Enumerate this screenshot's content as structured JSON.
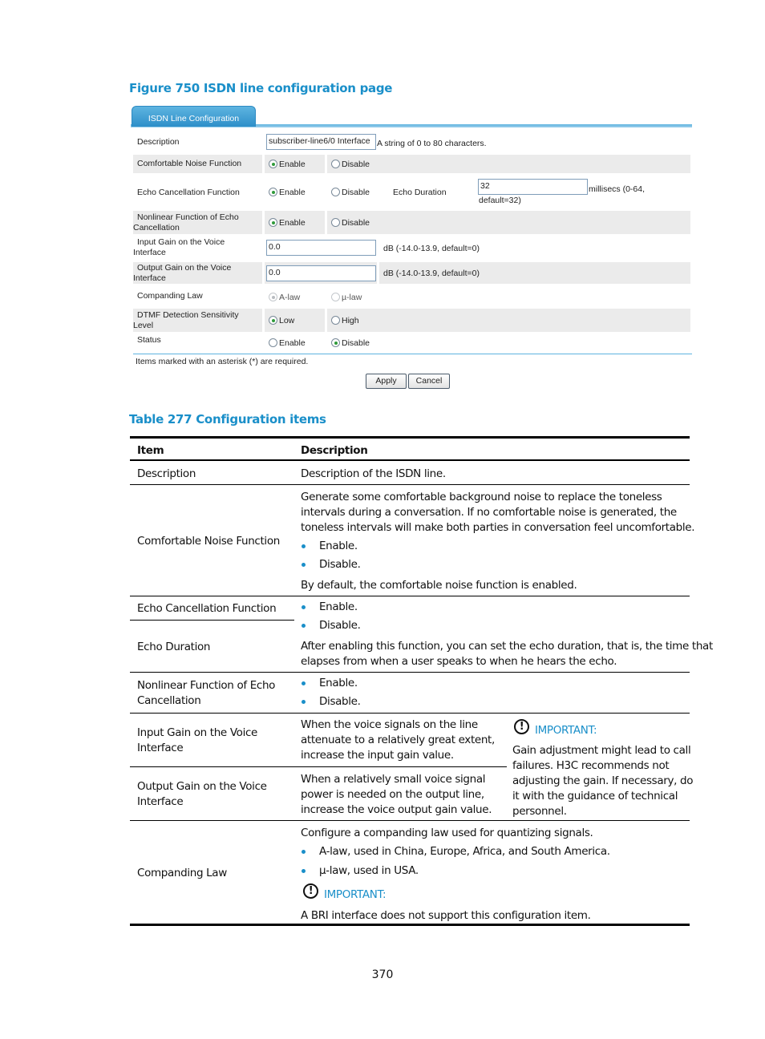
{
  "figure_caption": "Figure 750 ISDN line configuration page",
  "ui": {
    "tab_label": "ISDN Line Configuration",
    "rows": {
      "description": {
        "label": "Description",
        "value": "subscriber-line6/0 Interface",
        "hint": "A string of 0 to 80 characters."
      },
      "comfort_noise": {
        "label": "Comfortable Noise Function",
        "opt1": "Enable",
        "opt2": "Disable",
        "selected": "Enable"
      },
      "echo_cancel": {
        "label": "Echo Cancellation Function",
        "opt1": "Enable",
        "opt2": "Disable",
        "selected": "Enable",
        "duration_label": "Echo Duration",
        "duration_value": "32",
        "duration_hint1": "millisecs (0-64,",
        "duration_hint2": "default=32)"
      },
      "nonlinear": {
        "label1": "Nonlinear Function of Echo",
        "label2": "Cancellation",
        "opt1": "Enable",
        "opt2": "Disable",
        "selected": "Enable"
      },
      "input_gain": {
        "label1": "Input Gain on the Voice",
        "label2": "Interface",
        "value": "0.0",
        "hint": "dB (-14.0-13.9, default=0)"
      },
      "output_gain": {
        "label1": "Output Gain on the Voice",
        "label2": "Interface",
        "value": "0.0",
        "hint": "dB (-14.0-13.9, default=0)"
      },
      "companding": {
        "label": "Companding Law",
        "opt1": "A-law",
        "opt2": "µ-law",
        "selected": "A-law",
        "disabled": true
      },
      "dtmf": {
        "label1": "DTMF Detection Sensitivity",
        "label2": "Level",
        "opt1": "Low",
        "opt2": "High",
        "selected": "Low"
      },
      "status": {
        "label": "Status",
        "opt1": "Enable",
        "opt2": "Disable",
        "selected": "Disable"
      }
    },
    "note": "Items marked with an asterisk (*) are required.",
    "apply_label": "Apply",
    "cancel_label": "Cancel"
  },
  "table_caption": "Table 277 Configuration items",
  "table": {
    "headers": [
      "Item",
      "Description"
    ],
    "rows": {
      "description": {
        "item": "Description",
        "desc": "Description of the ISDN line."
      },
      "comfort_noise": {
        "item": "Comfortable Noise Function",
        "lines": [
          "Generate some comfortable background noise to replace the toneless",
          "intervals during a conversation. If no comfortable noise is generated, the",
          "toneless intervals will make both parties in conversation feel uncomfortable."
        ],
        "bullets": [
          "Enable.",
          "Disable."
        ],
        "footer": "By default, the comfortable noise function is enabled."
      },
      "echo_cancel": {
        "item": "Echo Cancellation Function",
        "bullets": [
          "Enable.",
          "Disable."
        ]
      },
      "echo_duration": {
        "item": "Echo Duration",
        "lines": [
          "After enabling this function, you can set the echo duration, that is, the time that",
          "elapses from when a user speaks to when he hears the echo."
        ]
      },
      "nonlinear": {
        "item_lines": [
          "Nonlinear Function of Echo",
          "Cancellation"
        ],
        "bullets": [
          "Enable.",
          "Disable."
        ]
      },
      "input_gain": {
        "item_lines": [
          "Input Gain on the Voice",
          "Interface"
        ],
        "lines": [
          "When the voice signals on the line",
          "attenuate to a relatively great extent,",
          "increase the input gain value."
        ]
      },
      "output_gain": {
        "item_lines": [
          "Output Gain on the Voice",
          "Interface"
        ],
        "lines": [
          "When a relatively small voice signal",
          "power is needed on the output line,",
          "increase the voice output gain value."
        ]
      },
      "gain_important": {
        "icon": "exclamation-circle-icon",
        "title": "IMPORTANT:",
        "lines": [
          "Gain adjustment might lead to call",
          "failures. H3C recommends not",
          "adjusting the gain. If necessary, do",
          "it with the guidance of technical",
          "personnel."
        ]
      },
      "companding": {
        "item": "Companding Law",
        "intro": "Configure a companding law used for quantizing signals.",
        "bullets": [
          "A-law, used in China, Europe, Africa, and South America.",
          "µ-law, used in USA."
        ],
        "important_title": "IMPORTANT:",
        "important_text": "A BRI interface does not support this configuration item."
      }
    }
  },
  "page_number": "370",
  "colors": {
    "accent": "#1a8fc9",
    "tab": "#2d8fc9",
    "row_shade": "#ebebeb",
    "radio_on": "#2f9a3a"
  }
}
